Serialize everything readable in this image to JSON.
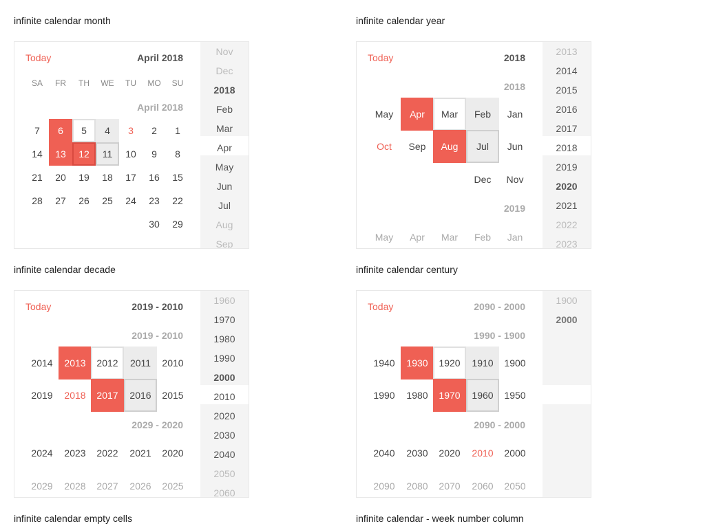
{
  "sections": {
    "month": "infinite calendar month",
    "year": "infinite calendar year",
    "decade": "infinite calendar decade",
    "century": "infinite calendar century",
    "empty": "infinite calendar empty cells",
    "weeknum": "infinite calendar - week number column"
  },
  "today_label": "Today",
  "colors": {
    "accent": "#ef6054",
    "sidebar_bg": "#f4f4f4",
    "gray_cell": "#ececec"
  },
  "month_cal": {
    "header": "April 2018",
    "weekdays": [
      "SA",
      "FR",
      "TH",
      "WE",
      "TU",
      "MO",
      "SU"
    ],
    "group_label": "April 2018",
    "rows": [
      [
        "7",
        "6",
        "5",
        "4",
        "3",
        "2",
        "1"
      ],
      [
        "14",
        "13",
        "12",
        "11",
        "10",
        "9",
        "8"
      ],
      [
        "21",
        "20",
        "19",
        "18",
        "17",
        "16",
        "15"
      ],
      [
        "28",
        "27",
        "26",
        "25",
        "24",
        "23",
        "22"
      ],
      [
        "",
        "",
        "",
        "",
        "",
        "30",
        "29"
      ]
    ],
    "sidebar": [
      "Nov",
      "Dec",
      "2018",
      "Feb",
      "Mar",
      "Apr",
      "May",
      "Jun",
      "Jul",
      "Aug",
      "Sep"
    ]
  },
  "year_cal": {
    "header": "2018",
    "group_label": "2018",
    "rows": [
      [
        "May",
        "Apr",
        "Mar",
        "Feb",
        "Jan"
      ],
      [
        "Oct",
        "Sep",
        "Aug",
        "Jul",
        "Jun"
      ],
      [
        "",
        "",
        "",
        "Dec",
        "Nov"
      ]
    ],
    "group2_label": "2019",
    "next_row": [
      "May",
      "Apr",
      "Mar",
      "Feb",
      "Jan"
    ],
    "sidebar": [
      "2013",
      "2014",
      "2015",
      "2016",
      "2017",
      "2018",
      "2019",
      "2020",
      "2021",
      "2022",
      "2023"
    ]
  },
  "decade_cal": {
    "header": "2019 - 2010",
    "group_label": "2019 - 2010",
    "rows": [
      [
        "2014",
        "2013",
        "2012",
        "2011",
        "2010"
      ],
      [
        "2019",
        "2018",
        "2017",
        "2016",
        "2015"
      ]
    ],
    "group2_label": "2029 - 2020",
    "rows2": [
      [
        "2024",
        "2023",
        "2022",
        "2021",
        "2020"
      ],
      [
        "2029",
        "2028",
        "2027",
        "2026",
        "2025"
      ]
    ],
    "sidebar": [
      "1960",
      "1970",
      "1980",
      "1990",
      "2000",
      "2010",
      "2020",
      "2030",
      "2040",
      "2050",
      "2060"
    ]
  },
  "century_cal": {
    "header": "2090 - 2000",
    "group_label": "1990 - 1900",
    "rows": [
      [
        "1940",
        "1930",
        "1920",
        "1910",
        "1900"
      ],
      [
        "1990",
        "1980",
        "1970",
        "1960",
        "1950"
      ]
    ],
    "group2_label": "2090 - 2000",
    "rows2": [
      [
        "2040",
        "2030",
        "2020",
        "2010",
        "2000"
      ],
      [
        "2090",
        "2080",
        "2070",
        "2060",
        "2050"
      ]
    ],
    "sidebar": [
      "1900",
      "2000"
    ]
  }
}
